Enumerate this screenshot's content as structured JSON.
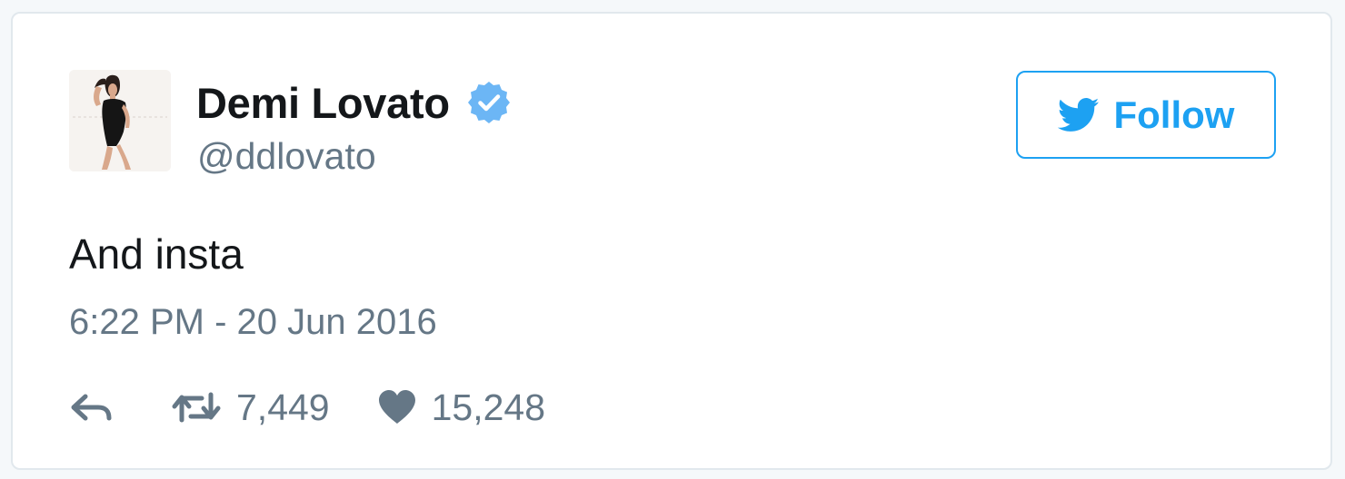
{
  "tweet": {
    "author": {
      "name": "Demi Lovato",
      "handle": "@ddlovato",
      "verified": true,
      "avatar": "profile-photo"
    },
    "follow_button": {
      "label": "Follow",
      "icon": "twitter-bird-icon"
    },
    "text": "And insta",
    "timestamp": "6:22 PM - 20 Jun 2016",
    "actions": {
      "reply_icon": "reply-icon",
      "retweet_icon": "retweet-icon",
      "retweet_count": "7,449",
      "like_icon": "heart-icon",
      "like_count": "15,248"
    }
  },
  "colors": {
    "brand_blue": "#1da1f2",
    "verified_blue": "#6cb6f5",
    "secondary_text": "#657786",
    "primary_text": "#14171a",
    "border": "#e1e8ed"
  }
}
